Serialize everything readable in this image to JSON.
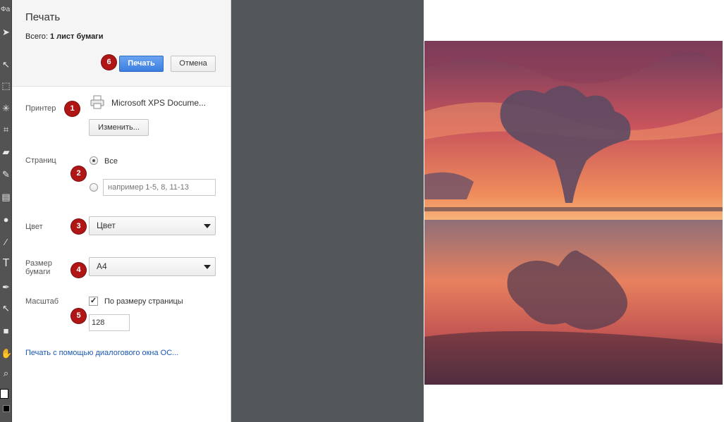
{
  "toolbar": {
    "menu_fragment": "Фа",
    "tools": [
      "arrow-tool-icon",
      "selection-tool-icon",
      "marquee-tool-icon",
      "magic-wand-icon",
      "crop-icon",
      "eraser-icon",
      "brush-icon",
      "gradient-icon",
      "blur-icon",
      "eyedropper-icon",
      "type-tool-icon",
      "pen-tool-icon",
      "direct-select-icon",
      "rectangle-tool-icon",
      "hand-tool-icon",
      "zoom-tool-icon"
    ]
  },
  "dialog": {
    "title": "Печать",
    "summary_prefix": "Всего:",
    "summary_value": "1 лист бумаги",
    "print_button": "Печать",
    "cancel_button": "Отмена",
    "print_badge": "6"
  },
  "printer": {
    "label": "Принтер",
    "badge": "1",
    "name": "Microsoft XPS Docume...",
    "change_button": "Изменить..."
  },
  "pages": {
    "label": "Страниц",
    "badge": "2",
    "all_label": "Все",
    "all_selected": true,
    "range_placeholder": "например 1-5, 8, 11-13"
  },
  "color": {
    "label": "Цвет",
    "badge": "3",
    "selected": "Цвет"
  },
  "paper_size": {
    "label_line1": "Размер",
    "label_line2": "бумаги",
    "badge": "4",
    "selected": "A4"
  },
  "scale": {
    "label": "Масштаб",
    "badge": "5",
    "fit_label": "По размеру страницы",
    "fit_checked": true,
    "value": "128"
  },
  "os_dialog_link": "Печать с помощью диалогового окна ОС...",
  "colors": {
    "badge": "#b01616",
    "primary_button": "#3c7ee0",
    "link": "#1a56b3",
    "preview_background": "#525659"
  }
}
